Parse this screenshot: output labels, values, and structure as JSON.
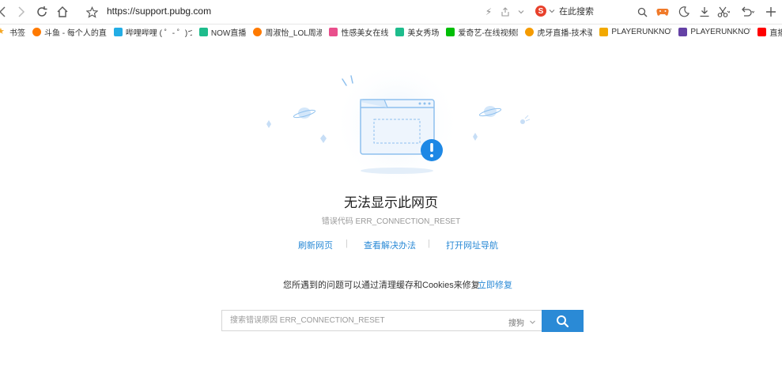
{
  "address_bar": {
    "url": "https://support.pubg.com"
  },
  "search_engine": {
    "label": "在此搜索",
    "logo_letter": "S"
  },
  "bookmarks": [
    {
      "label": "书签",
      "color": "#f5a623"
    },
    {
      "label": "斗鱼 - 每个人的直",
      "color": "#ff7a00"
    },
    {
      "label": "哔哩哔哩 ( ゜- ゜)つ",
      "color": "#23ade5"
    },
    {
      "label": "NOW直播",
      "color": "#1ebc8c"
    },
    {
      "label": "周淑怡_LOL周淑怡",
      "color": "#ff7a00"
    },
    {
      "label": "性感美女在线",
      "color": "#e94f8c"
    },
    {
      "label": "美女秀场",
      "color": "#1ebc8c"
    },
    {
      "label": "爱奇艺-在线视频网",
      "color": "#00be06"
    },
    {
      "label": "虎牙直播-技术驱",
      "color": "#f59b00"
    },
    {
      "label": "PLAYERUNKNOW",
      "color": "#f2a900"
    },
    {
      "label": "PLAYERUNKNOW",
      "color": "#6441a5"
    },
    {
      "label": "直播 - You",
      "color": "#ff0000"
    }
  ],
  "error": {
    "title": "无法显示此网页",
    "code": "错误代码 ERR_CONNECTION_RESET"
  },
  "actions": {
    "refresh": "刷新网页",
    "solutions": "查看解决办法",
    "open_nav": "打开网址导航",
    "separator": "|"
  },
  "hint": {
    "text": "您所遇到的问题可以通过清理缓存和Cookies来修复",
    "fix_link": "立即修复"
  },
  "search": {
    "placeholder": "搜索错误原因 ERR_CONNECTION_RESET",
    "engine": "搜狗"
  },
  "colors": {
    "accent": "#2a8ad6",
    "alert": "#1e88e5"
  },
  "icons": [
    "back-icon",
    "forward-icon",
    "reload-icon",
    "home-icon",
    "star-icon",
    "lightning-icon",
    "share-icon",
    "chevron-down-icon",
    "search-icon",
    "gamepad-icon",
    "moon-icon",
    "download-icon",
    "scissors-icon",
    "undo-icon",
    "plus-icon"
  ]
}
